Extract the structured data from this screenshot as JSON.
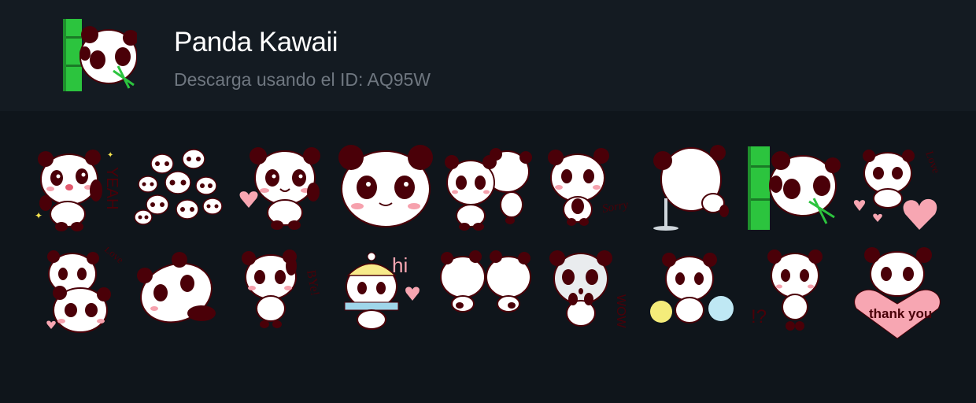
{
  "pack": {
    "title": "Panda Kawaii",
    "subtitle": "Descarga usando el ID: AQ95W"
  },
  "colors": {
    "background": "#0f151b",
    "header": "#141b22",
    "title": "#ffffff",
    "subtitle": "#6f7780",
    "panda_dark": "#4a0008",
    "blush": "#f6a1ad",
    "bamboo": "#27b83a",
    "heart": "#f7a6b2"
  },
  "stickers": [
    {
      "id": "yeah",
      "caption": "YEAH"
    },
    {
      "id": "crowd",
      "caption": ""
    },
    {
      "id": "heart-wave",
      "caption": ""
    },
    {
      "id": "big-face",
      "caption": ""
    },
    {
      "id": "two-pandas",
      "caption": ""
    },
    {
      "id": "sorry",
      "caption": "Sorry"
    },
    {
      "id": "faucet",
      "caption": ""
    },
    {
      "id": "bamboo",
      "caption": ""
    },
    {
      "id": "love-hearts",
      "caption": "Love"
    },
    {
      "id": "love-pair",
      "caption": "Love"
    },
    {
      "id": "lying",
      "caption": ""
    },
    {
      "id": "bye",
      "caption": "BYe!"
    },
    {
      "id": "hi-hat",
      "caption": "hi"
    },
    {
      "id": "backs",
      "caption": ""
    },
    {
      "id": "wow",
      "caption": "WOW"
    },
    {
      "id": "pompoms",
      "caption": ""
    },
    {
      "id": "question",
      "caption": "!?"
    },
    {
      "id": "thankyou",
      "caption": "thank you"
    }
  ]
}
